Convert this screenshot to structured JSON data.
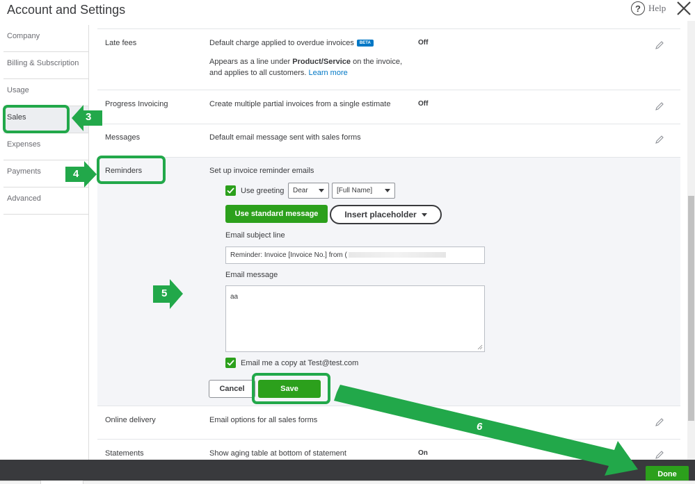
{
  "header": {
    "title": "Account and Settings",
    "help_label": "Help"
  },
  "sidebar": {
    "items": [
      {
        "label": "Company"
      },
      {
        "label": "Billing & Subscription"
      },
      {
        "label": "Usage"
      },
      {
        "label": "Sales",
        "active": true
      },
      {
        "label": "Expenses"
      },
      {
        "label": "Payments"
      },
      {
        "label": "Advanced"
      }
    ]
  },
  "rows": {
    "late_fees": {
      "label": "Late fees",
      "desc": "Default charge applied to overdue invoices",
      "badge": "BETA",
      "status": "Off",
      "detail_line1_pre": "Appears as a line under ",
      "detail_line1_bold": "Product/Service",
      "detail_line1_post": " on the invoice,",
      "detail_line2": "and applies to all customers. ",
      "learn_more": "Learn more"
    },
    "progress_invoicing": {
      "label": "Progress Invoicing",
      "desc": "Create multiple partial invoices from a single estimate",
      "status": "Off"
    },
    "messages": {
      "label": "Messages",
      "desc": "Default email message sent with sales forms"
    },
    "reminders": {
      "label": "Reminders",
      "desc": "Set up invoice reminder emails",
      "use_greeting_label": "Use greeting",
      "use_greeting_checked": true,
      "greeting_value": "Dear",
      "name_value": "[Full Name]",
      "use_standard_label": "Use standard message",
      "insert_placeholder_label": "Insert placeholder",
      "subject_label": "Email subject line",
      "subject_value": "Reminder: Invoice [Invoice No.] from (",
      "message_label": "Email message",
      "message_value": "aa",
      "copy_label": "Email me a copy at Test@test.com",
      "copy_checked": true,
      "cancel_label": "Cancel",
      "save_label": "Save"
    },
    "online_delivery": {
      "label": "Online delivery",
      "desc": "Email options for all sales forms"
    },
    "statements": {
      "label": "Statements",
      "desc": "Show aging table at bottom of statement",
      "status": "On"
    }
  },
  "footer": {
    "done_label": "Done"
  },
  "annotations": {
    "step3": "3",
    "step4": "4",
    "step5": "5",
    "step6": "6",
    "color": "#22a84a"
  },
  "colors": {
    "accent_green": "#2ca01c",
    "link_blue": "#0077c5",
    "footer_dark": "#393a3d"
  }
}
